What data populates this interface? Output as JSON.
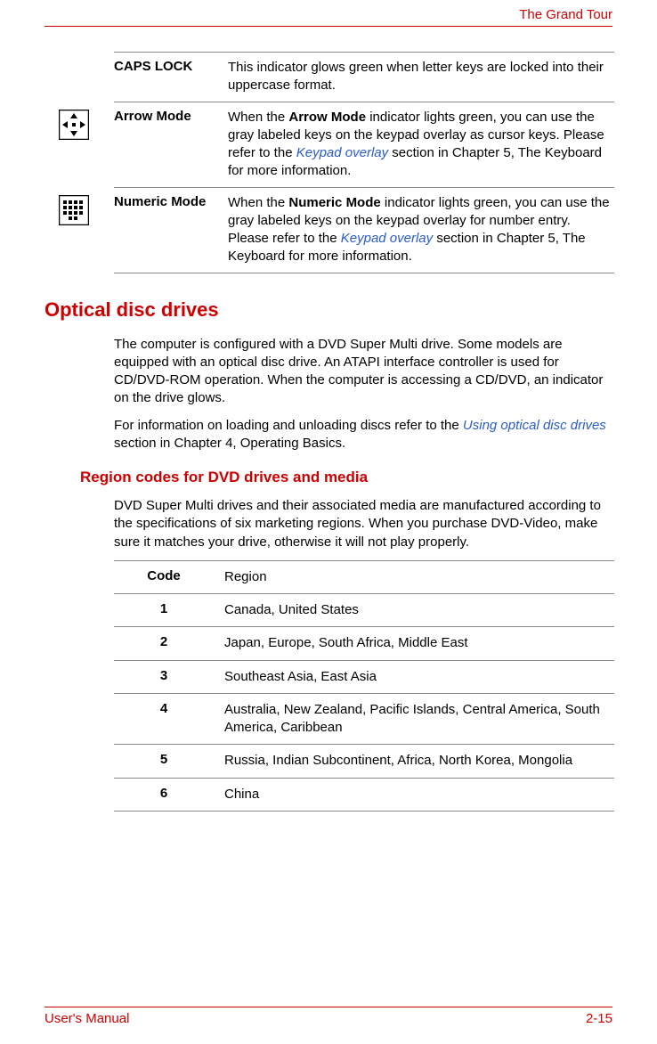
{
  "header": {
    "chapter": "The Grand Tour"
  },
  "indicators": [
    {
      "label": "CAPS LOCK",
      "desc_pre": "This indicator glows green when letter keys are locked into their uppercase format.",
      "bold": "",
      "desc_mid": "",
      "link": "",
      "desc_post": "",
      "icon": ""
    },
    {
      "label": "Arrow Mode",
      "desc_pre": "When the ",
      "bold": "Arrow Mode",
      "desc_mid": " indicator lights green, you can use the gray labeled keys on the keypad overlay as cursor keys. Please refer to the ",
      "link": "Keypad overlay",
      "desc_post": " section in Chapter 5, The Keyboard for more information.",
      "icon": "arrows"
    },
    {
      "label": "Numeric Mode",
      "desc_pre": "When the ",
      "bold": "Numeric Mode",
      "desc_mid": " indicator lights green, you can use the gray labeled keys on the keypad overlay for number entry. Please refer to the ",
      "link": "Keypad overlay",
      "desc_post": " section in Chapter 5, The Keyboard for more information.",
      "icon": "grid"
    }
  ],
  "section": {
    "h1": "Optical disc drives",
    "p1": "The computer is configured with a DVD Super Multi drive. Some models are equipped with an optical disc drive. An ATAPI interface controller is used for CD/DVD-ROM operation. When the computer is accessing a CD/DVD, an indicator on the drive glows.",
    "p2_pre": "For information on loading and unloading discs refer to the ",
    "p2_link": "Using optical disc drives",
    "p2_post": " section in Chapter 4, Operating Basics.",
    "h2": "Region codes for DVD drives and media",
    "p3": "DVD Super Multi drives and their associated media are manufactured according to the specifications of six marketing regions. When you purchase DVD-Video, make sure it matches your drive, otherwise it will not play properly."
  },
  "regionTable": {
    "header_code": "Code",
    "header_region": "Region",
    "rows": [
      {
        "code": "1",
        "region": "Canada, United States"
      },
      {
        "code": "2",
        "region": "Japan, Europe, South Africa, Middle East"
      },
      {
        "code": "3",
        "region": "Southeast Asia, East Asia"
      },
      {
        "code": "4",
        "region": "Australia, New Zealand, Pacific Islands, Central America, South America, Caribbean"
      },
      {
        "code": "5",
        "region": "Russia, Indian Subcontinent, Africa, North Korea, Mongolia"
      },
      {
        "code": "6",
        "region": "China"
      }
    ]
  },
  "footer": {
    "left": "User's Manual",
    "right": "2-15"
  }
}
